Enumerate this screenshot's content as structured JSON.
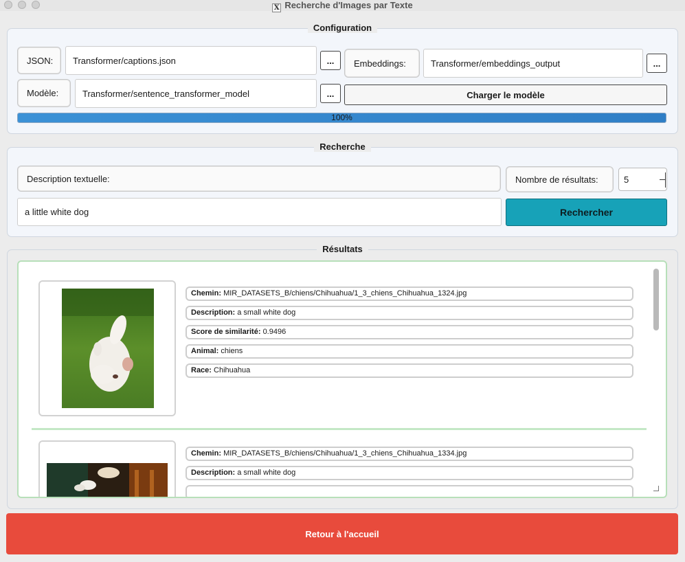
{
  "window": {
    "title": "Recherche d'Images par Texte",
    "app_icon": "x11-icon"
  },
  "configuration": {
    "title": "Configuration",
    "json_label": "JSON:",
    "json_value": "Transformer/captions.json",
    "browse_label": "...",
    "embeddings_label": "Embeddings:",
    "embeddings_value": "Transformer/embeddings_output",
    "model_label": "Modèle:",
    "model_value": "Transformer/sentence_transformer_model",
    "load_button": "Charger le modèle",
    "progress_text": "100%",
    "progress_fraction": 1.0
  },
  "search": {
    "title": "Recherche",
    "description_label": "Description textuelle:",
    "count_label": "Nombre de résultats:",
    "count_value": "5",
    "query": "a little white dog",
    "search_button": "Rechercher"
  },
  "results": {
    "title": "Résultats",
    "field_labels": {
      "path": "Chemin:",
      "description": "Description:",
      "score": "Score de similarité:",
      "animal": "Animal:",
      "breed": "Race:"
    },
    "items": [
      {
        "path": "MIR_DATASETS_B/chiens/Chihuahua/1_3_chiens_Chihuahua_1324.jpg",
        "description": "a small white dog",
        "score": "0.9496",
        "animal": "chiens",
        "breed": "Chihuahua"
      },
      {
        "path": "MIR_DATASETS_B/chiens/Chihuahua/1_3_chiens_Chihuahua_1334.jpg",
        "description": "a small white dog"
      }
    ]
  },
  "footer": {
    "home_button": "Retour à l'accueil"
  },
  "colors": {
    "search_button": "#17a2b8",
    "home_button": "#e84b3c",
    "progress": "#3b91d6",
    "result_border": "#b7dfb9"
  }
}
